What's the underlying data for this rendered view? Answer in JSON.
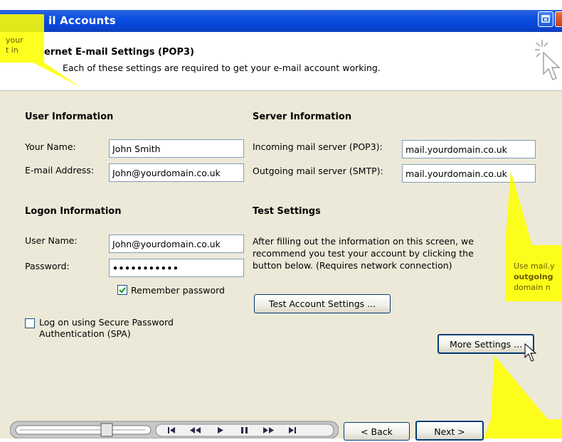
{
  "window": {
    "title": "il Accounts"
  },
  "header": {
    "title": "ernet E-mail Settings (POP3)",
    "subtitle": "Each of these settings are required to get your e-mail account working."
  },
  "user_info": {
    "heading": "User Information",
    "name_label": "Your Name:",
    "name_value": "John Smith",
    "email_label": "E-mail Address:",
    "email_value": "John@yourdomain.co.uk"
  },
  "server_info": {
    "heading": "Server Information",
    "incoming_label": "Incoming mail server (POP3):",
    "incoming_value": "mail.yourdomain.co.uk",
    "outgoing_label": "Outgoing mail server (SMTP):",
    "outgoing_value": "mail.yourdomain.co.uk"
  },
  "logon_info": {
    "heading": "Logon Information",
    "username_label": "User Name:",
    "username_value": "John@yourdomain.co.uk",
    "password_label": "Password:",
    "password_value": "•••••••••••",
    "remember_label": "Remember password",
    "remember_checked": true,
    "spa_label_line1": "Log on using Secure Password",
    "spa_label_line2": "Authentication (SPA)",
    "spa_checked": false
  },
  "test_settings": {
    "heading": "Test Settings",
    "desc_line1": "After filling out the information on this screen, we",
    "desc_line2": "recommend you test your account by clicking the",
    "desc_line3": "button below. (Requires network connection)",
    "test_button": "Test Account Settings ...",
    "more_button": "More Settings ..."
  },
  "nav": {
    "back": "< Back",
    "next": "Next >"
  },
  "callouts": {
    "left_line1": "your",
    "left_line2": "t in",
    "right_line1": "Use mail.y",
    "right_line2": "outgoing",
    "right_line3": "domain n"
  },
  "colors": {
    "titlebar": "#0846d8",
    "panel": "#ece9d8",
    "callout": "#ffff00",
    "checkmark": "#21a121"
  }
}
